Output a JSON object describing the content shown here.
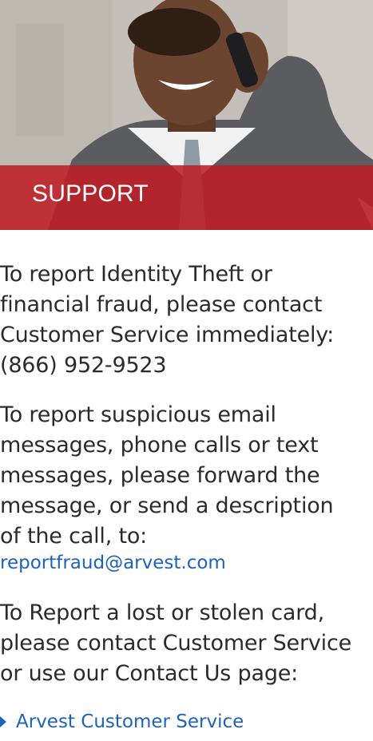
{
  "banner": {
    "title": "SUPPORT"
  },
  "content": {
    "para1_line1": "To report Identity Theft or",
    "para1_line2": "financial fraud, please contact",
    "para1_line3": "Customer Service immediately:",
    "para1_line4": "(866) 952-9523",
    "para2_line1": "To report suspicious email",
    "para2_line2": "messages, phone calls or text",
    "para2_line3": "messages, please forward the",
    "para2_line4": "message, or send a description",
    "para2_line5": "of the call, to:",
    "email": "reportfraud@arvest.com",
    "para3_line1": "To Report a lost or stolen card,",
    "para3_line2": "please contact Customer Service",
    "para3_line3": "or use our Contact Us page:",
    "link_label": "Arvest Customer Service"
  },
  "colors": {
    "banner_red": "#be1e26",
    "link_blue": "#1f62b9",
    "text": "#2b2b2b"
  },
  "icons": {
    "link_arrow": "triangle-right-icon"
  }
}
